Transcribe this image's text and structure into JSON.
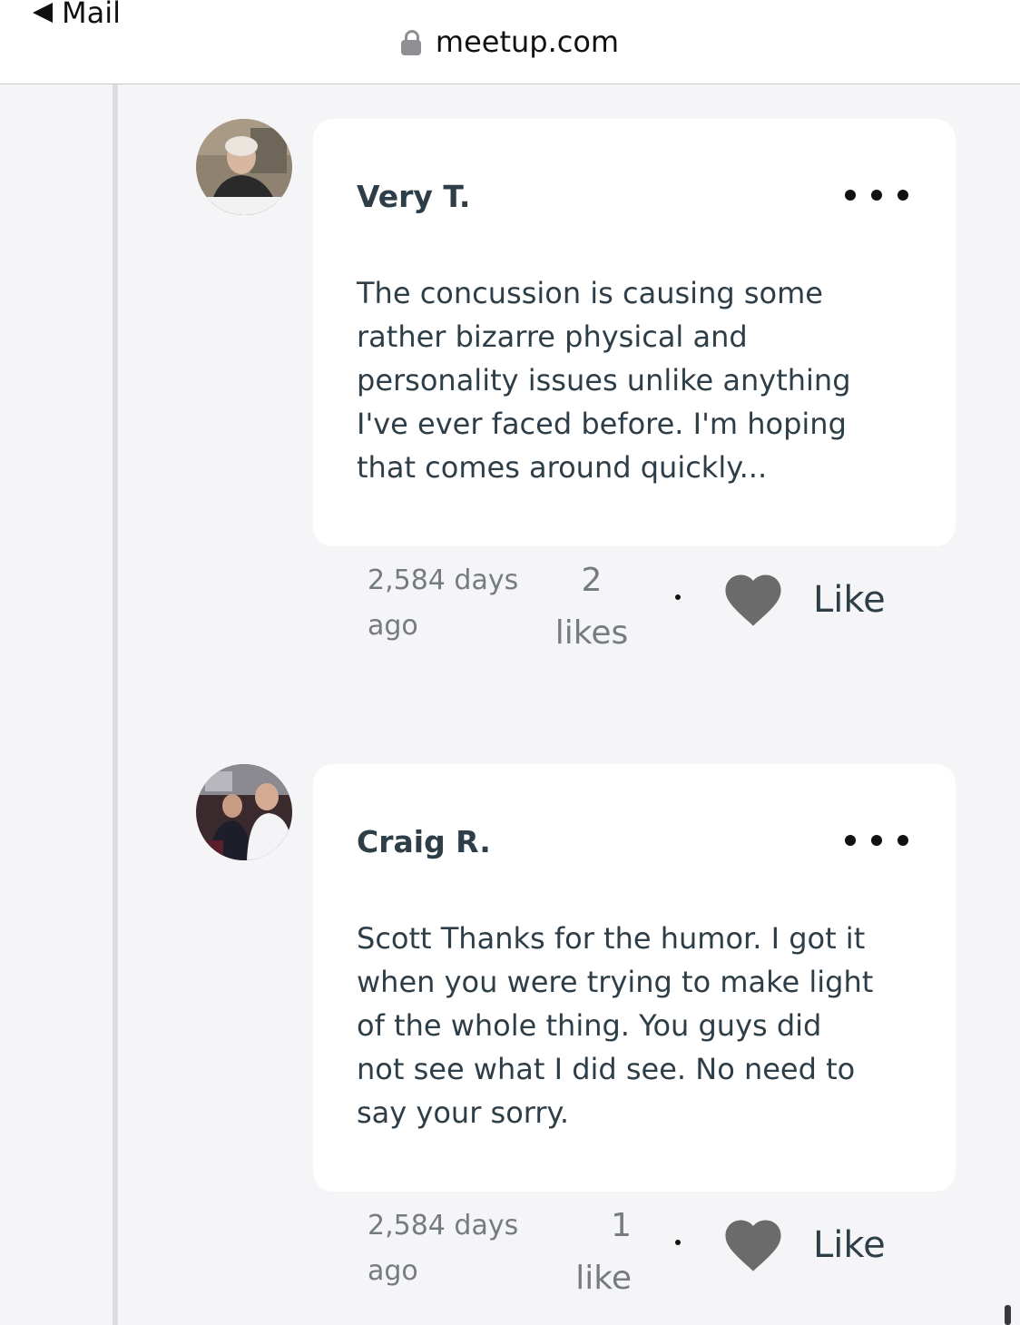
{
  "browser": {
    "back_label": "Mail",
    "url": "meetup.com"
  },
  "comments": [
    {
      "author": "Very T.",
      "body": "The concussion is causing some\nrather bizarre physical and\npersonality issues unlike anything\nI've ever faced before. I'm hoping\nthat comes around quickly...",
      "timestamp": "2,584 days\nago",
      "likes": "2\nlikes",
      "like_label": "Like"
    },
    {
      "author": "Craig R.",
      "body": "Scott Thanks for the humor. I got it\nwhen you were trying to make light\nof the whole thing. You guys did\nnot see what I did see. No need to\nsay your sorry.",
      "timestamp": "2,584 days\nago",
      "likes": "1\nlike",
      "like_label": "Like"
    }
  ],
  "icons": {
    "back": "back-triangle-icon",
    "lock": "lock-icon",
    "more": "ellipsis-icon",
    "like": "heart-icon"
  },
  "colors": {
    "page_background": "#f5f5f7",
    "card_background": "#ffffff",
    "text": "#2e3e48",
    "muted_text": "#757c80",
    "heart": "#6b6b6b"
  }
}
